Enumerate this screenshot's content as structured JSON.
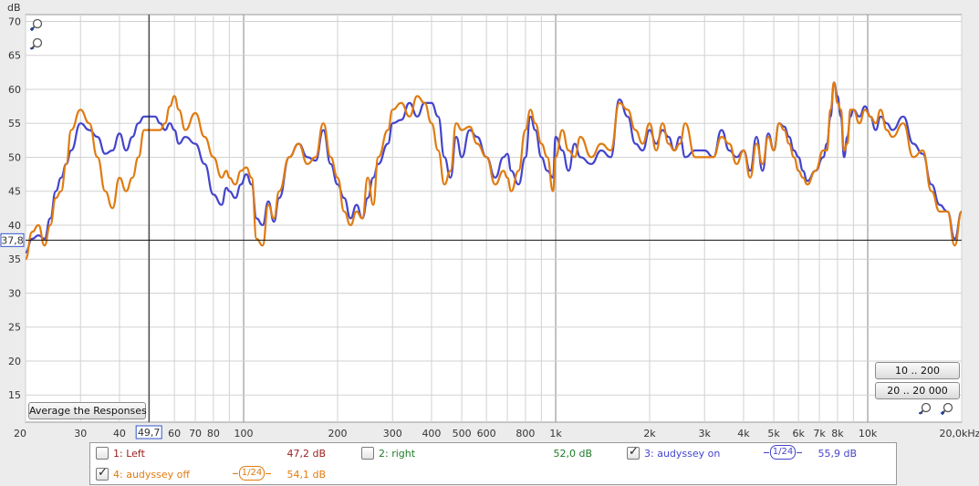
{
  "chart_data": {
    "type": "line",
    "title": "",
    "ylabel": "dB",
    "xlabel": "",
    "xscale": "log",
    "xlim": [
      20,
      20000
    ],
    "ylim": [
      11,
      71
    ],
    "grid": true,
    "y_ticks": [
      15,
      20,
      25,
      30,
      35,
      40,
      45,
      50,
      55,
      60,
      65,
      70
    ],
    "x_ticks": [
      {
        "v": 20,
        "label": "20"
      },
      {
        "v": 30,
        "label": "30"
      },
      {
        "v": 40,
        "label": "40"
      },
      {
        "v": 60,
        "label": "60"
      },
      {
        "v": 70,
        "label": "70"
      },
      {
        "v": 80,
        "label": "80"
      },
      {
        "v": 100,
        "label": "100"
      },
      {
        "v": 200,
        "label": "200"
      },
      {
        "v": 300,
        "label": "300"
      },
      {
        "v": 400,
        "label": "400"
      },
      {
        "v": 500,
        "label": "500"
      },
      {
        "v": 600,
        "label": "600"
      },
      {
        "v": 800,
        "label": "800"
      },
      {
        "v": 1000,
        "label": "1k"
      },
      {
        "v": 2000,
        "label": "2k"
      },
      {
        "v": 3000,
        "label": "3k"
      },
      {
        "v": 4000,
        "label": "4k"
      },
      {
        "v": 5000,
        "label": "5k"
      },
      {
        "v": 6000,
        "label": "6k"
      },
      {
        "v": 7000,
        "label": "7k"
      },
      {
        "v": 8000,
        "label": "8k"
      },
      {
        "v": 10000,
        "label": "10k"
      },
      {
        "v": 20000,
        "label": "20,0kHz"
      }
    ],
    "cursor": {
      "x": 49.7,
      "y": 37.8,
      "x_label": "49,7",
      "y_label": "37,8"
    },
    "series": [
      {
        "name": "audyssey on",
        "color": "#4444cc",
        "points": [
          [
            20,
            36
          ],
          [
            21,
            38
          ],
          [
            22,
            38.5
          ],
          [
            23,
            38
          ],
          [
            24,
            41
          ],
          [
            25,
            45
          ],
          [
            26,
            47
          ],
          [
            27,
            49
          ],
          [
            28,
            51
          ],
          [
            30,
            55
          ],
          [
            32,
            54
          ],
          [
            34,
            53
          ],
          [
            36,
            50.5
          ],
          [
            38,
            51
          ],
          [
            40,
            53.5
          ],
          [
            42,
            51
          ],
          [
            44,
            53
          ],
          [
            46,
            55
          ],
          [
            48,
            56
          ],
          [
            50,
            56
          ],
          [
            52,
            56
          ],
          [
            54,
            55
          ],
          [
            56,
            54
          ],
          [
            58,
            55
          ],
          [
            60,
            54
          ],
          [
            62,
            52
          ],
          [
            65,
            53
          ],
          [
            70,
            52
          ],
          [
            75,
            49
          ],
          [
            80,
            44.5
          ],
          [
            85,
            43
          ],
          [
            88,
            45.5
          ],
          [
            90,
            45
          ],
          [
            94,
            44
          ],
          [
            98,
            46
          ],
          [
            102,
            47.5
          ],
          [
            106,
            46
          ],
          [
            110,
            41
          ],
          [
            115,
            40
          ],
          [
            120,
            43.5
          ],
          [
            125,
            40.5
          ],
          [
            130,
            44
          ],
          [
            140,
            50
          ],
          [
            150,
            52
          ],
          [
            160,
            50
          ],
          [
            170,
            49.5
          ],
          [
            180,
            54
          ],
          [
            190,
            49
          ],
          [
            200,
            46
          ],
          [
            210,
            44
          ],
          [
            220,
            41
          ],
          [
            230,
            43
          ],
          [
            240,
            41
          ],
          [
            250,
            44
          ],
          [
            260,
            47
          ],
          [
            270,
            49
          ],
          [
            290,
            52
          ],
          [
            300,
            55
          ],
          [
            320,
            55.5
          ],
          [
            340,
            58
          ],
          [
            360,
            56
          ],
          [
            380,
            58
          ],
          [
            400,
            58
          ],
          [
            420,
            56
          ],
          [
            440,
            50
          ],
          [
            460,
            47
          ],
          [
            480,
            53
          ],
          [
            500,
            50
          ],
          [
            530,
            54
          ],
          [
            560,
            53
          ],
          [
            600,
            50
          ],
          [
            640,
            47
          ],
          [
            680,
            50
          ],
          [
            700,
            50.5
          ],
          [
            720,
            48
          ],
          [
            760,
            46
          ],
          [
            800,
            50
          ],
          [
            830,
            56
          ],
          [
            860,
            54
          ],
          [
            900,
            50
          ],
          [
            940,
            48
          ],
          [
            980,
            47
          ],
          [
            1000,
            53
          ],
          [
            1050,
            51
          ],
          [
            1100,
            48
          ],
          [
            1150,
            52
          ],
          [
            1200,
            50
          ],
          [
            1300,
            49
          ],
          [
            1400,
            51
          ],
          [
            1500,
            50
          ],
          [
            1600,
            58.5
          ],
          [
            1700,
            56
          ],
          [
            1800,
            52
          ],
          [
            1900,
            51
          ],
          [
            2000,
            54
          ],
          [
            2100,
            52
          ],
          [
            2200,
            54
          ],
          [
            2300,
            53
          ],
          [
            2400,
            51
          ],
          [
            2500,
            53
          ],
          [
            2600,
            50
          ],
          [
            2800,
            51
          ],
          [
            3000,
            51
          ],
          [
            3200,
            50
          ],
          [
            3400,
            54
          ],
          [
            3600,
            51
          ],
          [
            3800,
            50
          ],
          [
            4000,
            51
          ],
          [
            4200,
            48
          ],
          [
            4400,
            53
          ],
          [
            4600,
            48
          ],
          [
            4800,
            53.5
          ],
          [
            5000,
            51
          ],
          [
            5200,
            55
          ],
          [
            5400,
            54.5
          ],
          [
            5600,
            53
          ],
          [
            5800,
            51
          ],
          [
            6000,
            50
          ],
          [
            6200,
            48
          ],
          [
            6400,
            46.5
          ],
          [
            6800,
            48
          ],
          [
            7200,
            50
          ],
          [
            7400,
            52
          ],
          [
            7600,
            56
          ],
          [
            7800,
            61
          ],
          [
            8000,
            59
          ],
          [
            8200,
            56
          ],
          [
            8400,
            50
          ],
          [
            8600,
            53
          ],
          [
            8800,
            56
          ],
          [
            9000,
            57
          ],
          [
            9400,
            56
          ],
          [
            9800,
            57.5
          ],
          [
            10200,
            56
          ],
          [
            10600,
            54
          ],
          [
            11000,
            56
          ],
          [
            11500,
            55
          ],
          [
            12000,
            54
          ],
          [
            13000,
            56
          ],
          [
            14000,
            52
          ],
          [
            15000,
            50.5
          ],
          [
            16000,
            46
          ],
          [
            17000,
            43
          ],
          [
            18000,
            42
          ],
          [
            19000,
            38
          ],
          [
            20000,
            42
          ]
        ]
      },
      {
        "name": "audyssey off",
        "color": "#e07b10",
        "points": [
          [
            20,
            35
          ],
          [
            21,
            39
          ],
          [
            22,
            40
          ],
          [
            23,
            37
          ],
          [
            24,
            40
          ],
          [
            25,
            44
          ],
          [
            26,
            45
          ],
          [
            27,
            49
          ],
          [
            28,
            54
          ],
          [
            30,
            57
          ],
          [
            32,
            55
          ],
          [
            34,
            50
          ],
          [
            36,
            45
          ],
          [
            38,
            42.5
          ],
          [
            40,
            47
          ],
          [
            42,
            45
          ],
          [
            44,
            47
          ],
          [
            46,
            50
          ],
          [
            48,
            54
          ],
          [
            50,
            54
          ],
          [
            52,
            54
          ],
          [
            54,
            54
          ],
          [
            56,
            55
          ],
          [
            58,
            57.5
          ],
          [
            60,
            59
          ],
          [
            62,
            57
          ],
          [
            65,
            54
          ],
          [
            70,
            56.5
          ],
          [
            75,
            53
          ],
          [
            80,
            50
          ],
          [
            85,
            47
          ],
          [
            88,
            48
          ],
          [
            90,
            47
          ],
          [
            94,
            46
          ],
          [
            98,
            48
          ],
          [
            102,
            48.5
          ],
          [
            106,
            47
          ],
          [
            110,
            38
          ],
          [
            115,
            37
          ],
          [
            120,
            43
          ],
          [
            125,
            41
          ],
          [
            130,
            45
          ],
          [
            140,
            50
          ],
          [
            150,
            52
          ],
          [
            160,
            49
          ],
          [
            170,
            50
          ],
          [
            180,
            55
          ],
          [
            190,
            50
          ],
          [
            200,
            47
          ],
          [
            210,
            42
          ],
          [
            220,
            40
          ],
          [
            230,
            42
          ],
          [
            240,
            41
          ],
          [
            250,
            47
          ],
          [
            260,
            43
          ],
          [
            270,
            50
          ],
          [
            290,
            54
          ],
          [
            300,
            57
          ],
          [
            320,
            58
          ],
          [
            340,
            56
          ],
          [
            360,
            59
          ],
          [
            380,
            58
          ],
          [
            400,
            55
          ],
          [
            420,
            51
          ],
          [
            440,
            46
          ],
          [
            460,
            48
          ],
          [
            480,
            55
          ],
          [
            500,
            54
          ],
          [
            530,
            54.5
          ],
          [
            560,
            52
          ],
          [
            600,
            50
          ],
          [
            640,
            46
          ],
          [
            680,
            48
          ],
          [
            700,
            47
          ],
          [
            720,
            45
          ],
          [
            760,
            48
          ],
          [
            800,
            54
          ],
          [
            830,
            57
          ],
          [
            860,
            55
          ],
          [
            900,
            52
          ],
          [
            940,
            50
          ],
          [
            980,
            45
          ],
          [
            1000,
            50
          ],
          [
            1050,
            54
          ],
          [
            1100,
            51
          ],
          [
            1150,
            50
          ],
          [
            1200,
            53
          ],
          [
            1300,
            50
          ],
          [
            1400,
            52
          ],
          [
            1500,
            51
          ],
          [
            1600,
            58
          ],
          [
            1700,
            57
          ],
          [
            1800,
            54
          ],
          [
            1900,
            52
          ],
          [
            2000,
            55
          ],
          [
            2100,
            51
          ],
          [
            2200,
            55
          ],
          [
            2300,
            52
          ],
          [
            2400,
            51
          ],
          [
            2500,
            52
          ],
          [
            2600,
            55
          ],
          [
            2800,
            50
          ],
          [
            3000,
            50
          ],
          [
            3200,
            50
          ],
          [
            3400,
            53
          ],
          [
            3600,
            52
          ],
          [
            3800,
            49
          ],
          [
            4000,
            51
          ],
          [
            4200,
            47
          ],
          [
            4400,
            52
          ],
          [
            4600,
            49
          ],
          [
            4800,
            53
          ],
          [
            5000,
            51
          ],
          [
            5200,
            55
          ],
          [
            5400,
            54
          ],
          [
            5600,
            52
          ],
          [
            5800,
            50
          ],
          [
            6000,
            48
          ],
          [
            6200,
            47
          ],
          [
            6400,
            46
          ],
          [
            6800,
            48
          ],
          [
            7200,
            51
          ],
          [
            7400,
            51
          ],
          [
            7600,
            57
          ],
          [
            7800,
            61
          ],
          [
            8000,
            58
          ],
          [
            8200,
            57
          ],
          [
            8400,
            51
          ],
          [
            8600,
            52
          ],
          [
            8800,
            57
          ],
          [
            9000,
            57
          ],
          [
            9400,
            55
          ],
          [
            9800,
            57
          ],
          [
            10200,
            56
          ],
          [
            10600,
            55
          ],
          [
            11000,
            57
          ],
          [
            11500,
            54
          ],
          [
            12000,
            53
          ],
          [
            13000,
            55
          ],
          [
            14000,
            50
          ],
          [
            15000,
            51
          ],
          [
            16000,
            45
          ],
          [
            17000,
            42
          ],
          [
            18000,
            42
          ],
          [
            19000,
            37
          ],
          [
            20000,
            42
          ]
        ]
      }
    ]
  },
  "buttons": {
    "average": "Average the Responses",
    "range1": "10 .. 200",
    "range2": "20 .. 20 000"
  },
  "legend": [
    {
      "id": "1",
      "label": "1: Left",
      "value": "47,2 dB",
      "color": "#9b1c1c",
      "checked": false,
      "smooth": ""
    },
    {
      "id": "2",
      "label": "2: right",
      "value": "52,0 dB",
      "color": "#1f7a2a",
      "checked": false,
      "smooth": ""
    },
    {
      "id": "3",
      "label": "3: audyssey on",
      "value": "55,9 dB",
      "color": "#4444cc",
      "checked": true,
      "smooth": "1/24"
    },
    {
      "id": "4",
      "label": "4: audyssey off",
      "value": "54,1 dB",
      "color": "#e07b10",
      "checked": true,
      "smooth": "1/24"
    }
  ]
}
